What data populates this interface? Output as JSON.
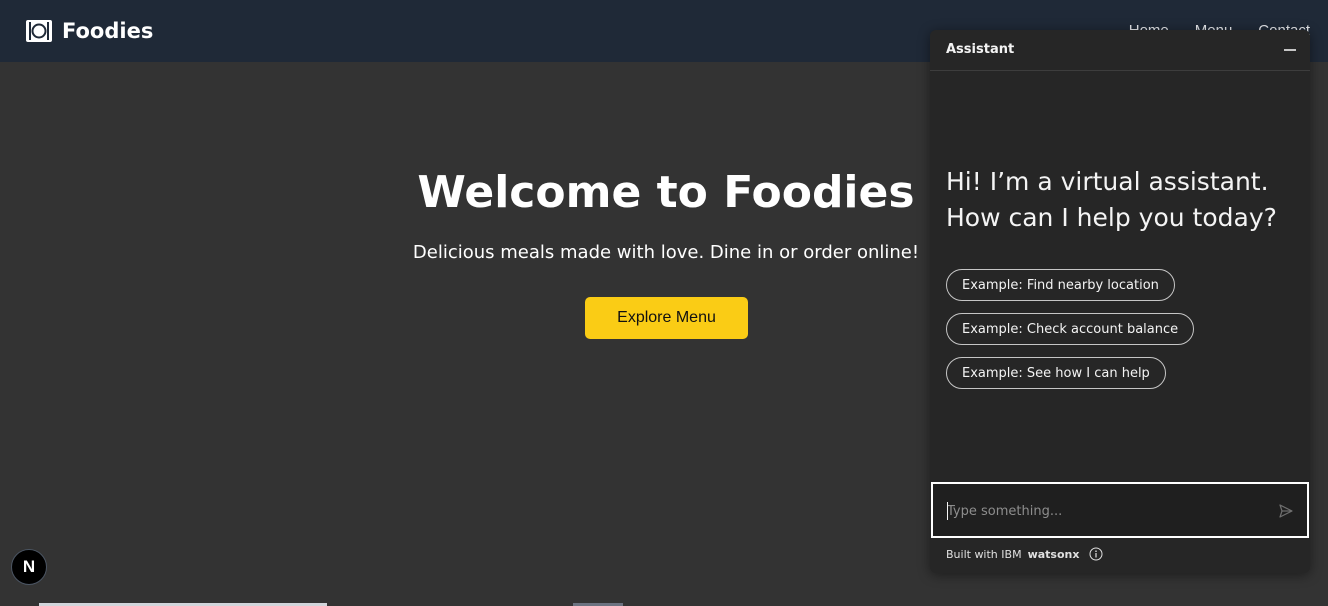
{
  "header": {
    "brand_name": "Foodies",
    "brand_icon": "plate-cutlery-icon",
    "nav": [
      "Home",
      "Menu",
      "Contact"
    ]
  },
  "hero": {
    "title": "Welcome to Foodies",
    "subtitle": "Delicious meals made with love. Dine in or order online!",
    "cta_label": "Explore Menu"
  },
  "assistant": {
    "title": "Assistant",
    "greeting_line1": "Hi! I’m a virtual assistant.",
    "greeting_line2": "How can I help you today?",
    "examples": [
      "Example: Find nearby location",
      "Example: Check account balance",
      "Example: See how I can help"
    ],
    "input_placeholder": "Type something...",
    "footer_prefix": "Built with IBM",
    "footer_brand": "watsonx"
  },
  "badge": {
    "label": "N"
  },
  "colors": {
    "page_bg": "#333333",
    "header_bg": "#1f2937",
    "accent": "#facc15",
    "panel_bg": "#262626"
  }
}
